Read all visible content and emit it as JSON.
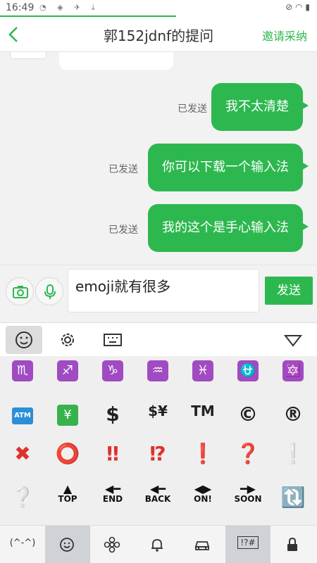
{
  "status_bar": {
    "time": "16:49"
  },
  "header": {
    "title": "郭152jdnf的提问",
    "invite_label": "邀请采纳"
  },
  "messages": [
    {
      "status": "已发送",
      "text": "我不太清楚"
    },
    {
      "status": "已发送",
      "text": "你可以下载一个输入法"
    },
    {
      "status": "已发送",
      "text": "我的这个是手心输入法"
    }
  ],
  "input": {
    "value": "emoji就有很多",
    "send_label": "发送"
  },
  "keyboard": {
    "top_tabs": [
      "smiley-icon",
      "gear-icon",
      "keyboard-icon",
      "collapse-triangle-icon"
    ],
    "emoji_rows": [
      [
        "♏",
        "♐",
        "♑",
        "♒",
        "♓",
        "⛎",
        "🔯"
      ],
      [
        "ATM",
        "¥",
        "$",
        "$¥",
        "TM",
        "©",
        "®"
      ],
      [
        "✖",
        "⭕",
        "‼",
        "⁉",
        "❗",
        "❓",
        "❕"
      ],
      [
        "❔",
        "TOP",
        "END",
        "BACK",
        "ON!",
        "SOON",
        "🔃"
      ]
    ],
    "bottom_tabs": [
      {
        "name": "kaomoji-tab",
        "label": "(^-^)"
      },
      {
        "name": "smiley-tab-icon"
      },
      {
        "name": "flower-tab-icon"
      },
      {
        "name": "bell-tab-icon"
      },
      {
        "name": "car-tab-icon"
      },
      {
        "name": "symbols-tab",
        "label": "!?#"
      },
      {
        "name": "lock-tab-icon"
      }
    ]
  },
  "colors": {
    "accent": "#2db84f",
    "bubble": "#2db84f",
    "purple_emoji": "#a04bc2",
    "red_emoji": "#e0312e"
  }
}
